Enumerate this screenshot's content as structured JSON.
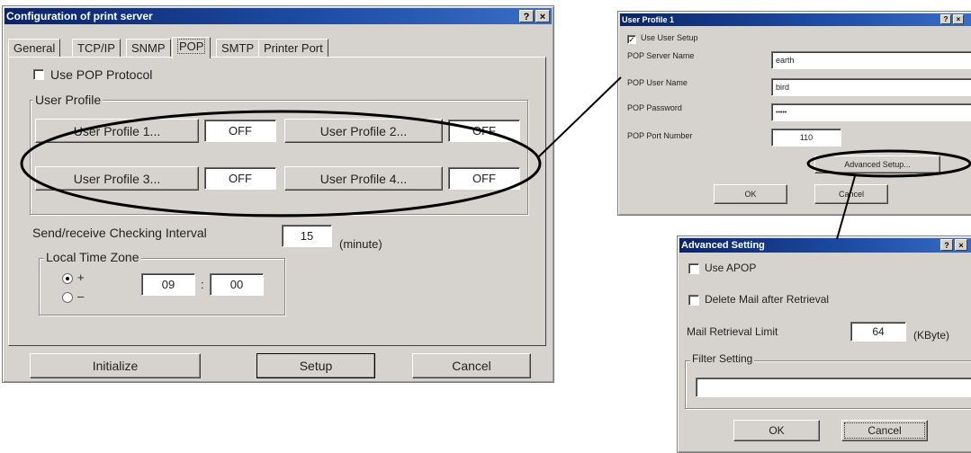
{
  "main": {
    "title": "Configuration of print server",
    "help_btn": "?",
    "close_btn": "×",
    "tabs": [
      "General",
      "TCP/IP",
      "SNMP",
      "POP",
      "SMTP",
      "Printer Port"
    ],
    "active_tab": "POP",
    "use_pop_label": "Use POP Protocol",
    "user_profile_group": "User Profile",
    "profiles": [
      {
        "label": "User Profile 1...",
        "status": "OFF"
      },
      {
        "label": "User Profile 2...",
        "status": "OFF"
      },
      {
        "label": "User Profile 3...",
        "status": "OFF"
      },
      {
        "label": "User Profile 4...",
        "status": "OFF"
      }
    ],
    "interval_label": "Send/receive Checking Interval",
    "interval_value": "15",
    "interval_unit": "(minute)",
    "tz_group": "Local Time Zone",
    "tz_plus": "+",
    "tz_minus": "–",
    "tz_hours": "09",
    "tz_sep": ":",
    "tz_minutes": "00",
    "buttons": {
      "initialize": "Initialize",
      "setup": "Setup",
      "cancel": "Cancel"
    }
  },
  "profile_dialog": {
    "title": "User Profile 1",
    "help_btn": "?",
    "close_btn": "×",
    "use_user_setup": "Use User Setup",
    "server_name_label": "POP Server Name",
    "server_name_value": "earth",
    "user_name_label": "POP User Name",
    "user_name_value": "bird",
    "password_label": "POP Password",
    "password_value": "•••••",
    "port_label": "POP Port Number",
    "port_value": "110",
    "advanced_btn": "Advanced Setup...",
    "ok_btn": "OK",
    "cancel_btn": "Cancel"
  },
  "advanced_dialog": {
    "title": "Advanced Setting",
    "help_btn": "?",
    "close_btn": "×",
    "use_apop": "Use APOP",
    "delete_mail": "Delete Mail after Retrieval",
    "limit_label": "Mail Retrieval Limit",
    "limit_value": "64",
    "limit_unit": "(KByte)",
    "filter_group": "Filter Setting",
    "filter_value": "",
    "ok_btn": "OK",
    "cancel_btn": "Cancel"
  },
  "colors": {
    "titlebar": "#0a246a",
    "face": "#d6d3ce"
  }
}
